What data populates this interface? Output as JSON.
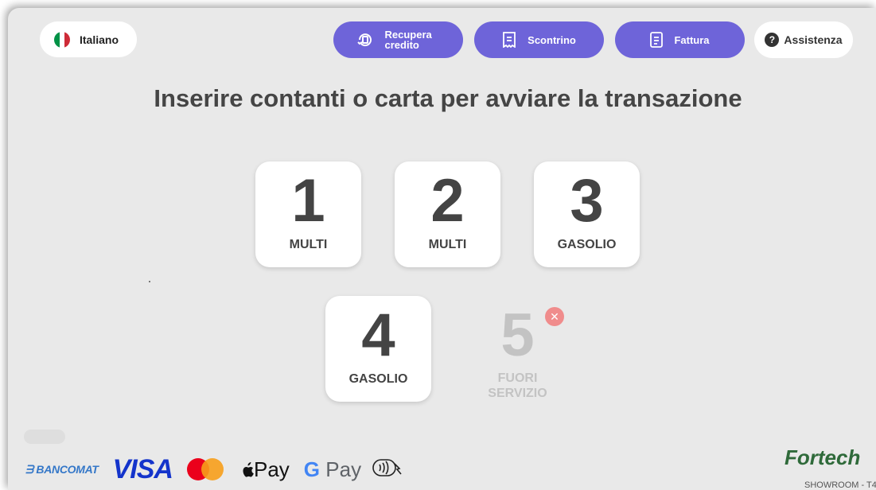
{
  "header": {
    "language": {
      "label": "Italiano",
      "flag_colors": [
        "#009246",
        "#ffffff",
        "#ce2b37"
      ]
    },
    "buttons": [
      {
        "label": "Recupera credito",
        "icon": "credit-recovery-icon"
      },
      {
        "label": "Scontrino",
        "icon": "receipt-icon"
      },
      {
        "label": "Fattura",
        "icon": "invoice-icon"
      }
    ],
    "help": {
      "label": "Assistenza",
      "icon_glyph": "?"
    }
  },
  "main": {
    "title": "Inserire contanti o carta per avviare la transazione",
    "pumps": [
      {
        "number": "1",
        "fuel": "MULTI",
        "status": "available"
      },
      {
        "number": "2",
        "fuel": "MULTI",
        "status": "available"
      },
      {
        "number": "3",
        "fuel": "GASOLIO",
        "status": "available"
      },
      {
        "number": "4",
        "fuel": "GASOLIO",
        "status": "available"
      },
      {
        "number": "5",
        "fuel": "FUORI SERVIZIO",
        "status": "out-of-service"
      }
    ]
  },
  "footer": {
    "payment_methods": [
      "BANCOMAT",
      "VISA",
      "Mastercard",
      "Pay",
      "Pay"
    ],
    "payment_labels": {
      "bancomat": "BANCOMAT",
      "visa": "VISA",
      "apple_pay": "Pay",
      "google_pay_g": "G",
      "google_pay": "Pay"
    },
    "brand": "Fortech",
    "location": "SHOWROOM - T4"
  },
  "colors": {
    "accent": "#6e64d9",
    "background": "#e9e9e9",
    "error_badge": "#f08c8c"
  }
}
